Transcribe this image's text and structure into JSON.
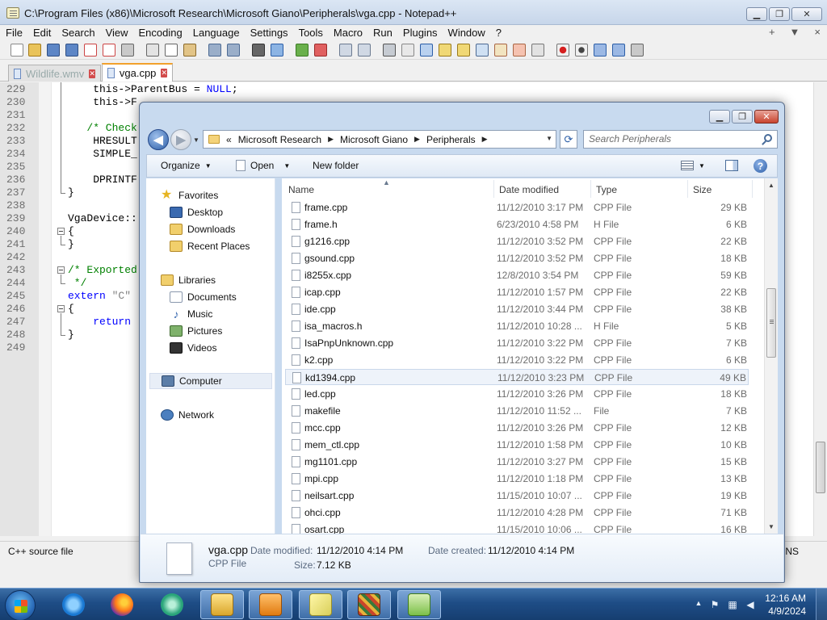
{
  "notepad": {
    "title": "C:\\Program Files (x86)\\Microsoft Research\\Microsoft Giano\\Peripherals\\vga.cpp - Notepad++",
    "menu": [
      "File",
      "Edit",
      "Search",
      "View",
      "Encoding",
      "Language",
      "Settings",
      "Tools",
      "Macro",
      "Run",
      "Plugins",
      "Window",
      "?"
    ],
    "menu_right": [
      "+",
      "▼",
      "×"
    ],
    "tabs": [
      {
        "label": "Wildlife.wmv",
        "active": false
      },
      {
        "label": "vga.cpp",
        "active": true
      }
    ],
    "code_lines": [
      {
        "n": "229",
        "text": "    this->ParentBus = NULL;"
      },
      {
        "n": "230",
        "text": "    this->F"
      },
      {
        "n": "231",
        "text": ""
      },
      {
        "n": "232",
        "text": "   /* Check"
      },
      {
        "n": "233",
        "text": "    HRESULT"
      },
      {
        "n": "234",
        "text": "    SIMPLE_"
      },
      {
        "n": "235",
        "text": ""
      },
      {
        "n": "236",
        "text": "    DPRINTF"
      },
      {
        "n": "237",
        "text": "}"
      },
      {
        "n": "238",
        "text": ""
      },
      {
        "n": "239",
        "text": "VgaDevice::"
      },
      {
        "n": "240",
        "text": "{"
      },
      {
        "n": "241",
        "text": "}"
      },
      {
        "n": "242",
        "text": ""
      },
      {
        "n": "243",
        "text": "/* Exported"
      },
      {
        "n": "244",
        "text": " */"
      },
      {
        "n": "245",
        "text": "extern \"C\""
      },
      {
        "n": "246",
        "text": "{"
      },
      {
        "n": "247",
        "text": "    return"
      },
      {
        "n": "248",
        "text": "}"
      },
      {
        "n": "249",
        "text": ""
      }
    ],
    "status_left": "C++ source file",
    "status_right": "INS"
  },
  "dialog": {
    "breadcrumb": [
      "Microsoft Research",
      "Microsoft Giano",
      "Peripherals"
    ],
    "breadcrumb_prefix": "«",
    "search_placeholder": "Search Peripherals",
    "toolbar": {
      "organize": "Organize",
      "open": "Open",
      "new_folder": "New folder"
    },
    "nav": [
      {
        "label": "Favorites",
        "icon": "star-icon"
      },
      {
        "label": "Desktop",
        "icon": "desktop-icon"
      },
      {
        "label": "Downloads",
        "icon": "downloads-icon"
      },
      {
        "label": "Recent Places",
        "icon": "recent-places-icon"
      },
      {
        "label": "Libraries",
        "icon": "libraries-icon"
      },
      {
        "label": "Documents",
        "icon": "documents-icon"
      },
      {
        "label": "Music",
        "icon": "music-icon"
      },
      {
        "label": "Pictures",
        "icon": "pictures-icon"
      },
      {
        "label": "Videos",
        "icon": "videos-icon"
      },
      {
        "label": "Computer",
        "icon": "computer-icon"
      },
      {
        "label": "Network",
        "icon": "network-icon"
      }
    ],
    "columns": {
      "name": "Name",
      "date": "Date modified",
      "type": "Type",
      "size": "Size"
    },
    "files": [
      {
        "name": "frame.cpp",
        "date": "11/12/2010 3:17 PM",
        "type": "CPP File",
        "size": "29 KB"
      },
      {
        "name": "frame.h",
        "date": "6/23/2010 4:58 PM",
        "type": "H File",
        "size": "6 KB"
      },
      {
        "name": "g1216.cpp",
        "date": "11/12/2010 3:52 PM",
        "type": "CPP File",
        "size": "22 KB"
      },
      {
        "name": "gsound.cpp",
        "date": "11/12/2010 3:52 PM",
        "type": "CPP File",
        "size": "18 KB"
      },
      {
        "name": "i8255x.cpp",
        "date": "12/8/2010 3:54 PM",
        "type": "CPP File",
        "size": "59 KB"
      },
      {
        "name": "icap.cpp",
        "date": "11/12/2010 1:57 PM",
        "type": "CPP File",
        "size": "22 KB"
      },
      {
        "name": "ide.cpp",
        "date": "11/12/2010 3:44 PM",
        "type": "CPP File",
        "size": "38 KB"
      },
      {
        "name": "isa_macros.h",
        "date": "11/12/2010 10:28 ...",
        "type": "H File",
        "size": "5 KB"
      },
      {
        "name": "IsaPnpUnknown.cpp",
        "date": "11/12/2010 3:22 PM",
        "type": "CPP File",
        "size": "7 KB"
      },
      {
        "name": "k2.cpp",
        "date": "11/12/2010 3:22 PM",
        "type": "CPP File",
        "size": "6 KB"
      },
      {
        "name": "kd1394.cpp",
        "date": "11/12/2010 3:23 PM",
        "type": "CPP File",
        "size": "49 KB"
      },
      {
        "name": "led.cpp",
        "date": "11/12/2010 3:26 PM",
        "type": "CPP File",
        "size": "18 KB"
      },
      {
        "name": "makefile",
        "date": "11/12/2010 11:52 ...",
        "type": "File",
        "size": "7 KB"
      },
      {
        "name": "mcc.cpp",
        "date": "11/12/2010 3:26 PM",
        "type": "CPP File",
        "size": "12 KB"
      },
      {
        "name": "mem_ctl.cpp",
        "date": "11/12/2010 1:58 PM",
        "type": "CPP File",
        "size": "10 KB"
      },
      {
        "name": "mg1101.cpp",
        "date": "11/12/2010 3:27 PM",
        "type": "CPP File",
        "size": "15 KB"
      },
      {
        "name": "mpi.cpp",
        "date": "11/12/2010 1:18 PM",
        "type": "CPP File",
        "size": "13 KB"
      },
      {
        "name": "neilsart.cpp",
        "date": "11/15/2010 10:07 ...",
        "type": "CPP File",
        "size": "19 KB"
      },
      {
        "name": "ohci.cpp",
        "date": "11/12/2010 4:28 PM",
        "type": "CPP File",
        "size": "71 KB"
      },
      {
        "name": "osart.cpp",
        "date": "11/15/2010 10:06 ...",
        "type": "CPP File",
        "size": "16 KB"
      }
    ],
    "details": {
      "name": "vga.cpp",
      "type": "CPP File",
      "modified_label": "Date modified:",
      "modified": "11/12/2010 4:14 PM",
      "created_label": "Date created:",
      "created": "11/12/2010 4:14 PM",
      "size_label": "Size:",
      "size": "7.12 KB"
    }
  },
  "taskbar": {
    "time": "12:16 AM",
    "date": "4/9/2024",
    "apps": [
      "internet-explorer-icon",
      "firefox-icon",
      "chat-icon",
      "explorer-icon",
      "media-player-icon",
      "sticky-notes-icon",
      "game-icon",
      "notepad-plus-plus-icon"
    ]
  }
}
